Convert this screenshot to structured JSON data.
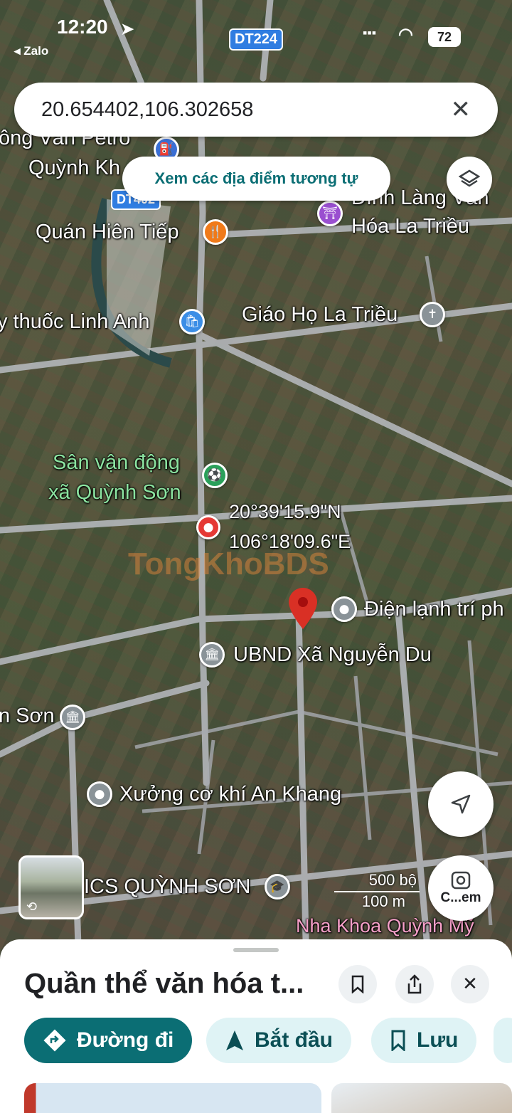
{
  "status_bar": {
    "time": "12:20",
    "back_app": "◂ Zalo",
    "signal": "▪▪▪",
    "battery": "72"
  },
  "road_badges": [
    "DT224",
    "DT402"
  ],
  "search": {
    "query": "20.654402,106.302658"
  },
  "similar_places_chip": "Xem các địa điểm tương tự",
  "map_labels": {
    "petro": "ông Văn Petro",
    "petro2": "Quỳnh Kh",
    "dinh_lang": "Đình Làng Văn",
    "dinh_lang2": "Hóa La Triều",
    "quan_hien_tiep": "Quán Hiên Tiếp",
    "thuoc": "y thuốc Linh Anh",
    "giao_ho": "Giáo Họ La Triều",
    "svd1": "Sân vận động",
    "svd2": "xã Quỳnh Sơn",
    "coord_lat": "20°39'15.9\"N",
    "coord_lng": "106°18'09.6\"E",
    "watermark": "TongKhoBDS",
    "dien_lanh": "Điện lạnh trí ph",
    "ubnd": "UBND Xã Nguyễn Du",
    "son": "n Sơn",
    "xuong": "Xưởng cơ khí An Khang",
    "thcs": "ICS QUỲNH SƠN",
    "nha_khoa": "Nha Khoa Quỳnh Mỹ"
  },
  "scale": {
    "top": "500 bộ",
    "bottom": "100 m"
  },
  "camera_button_label": "C...em",
  "place": {
    "title": "Quần thể văn hóa t...",
    "actions": {
      "directions": "Đường đi",
      "start": "Bắt đầu",
      "save": "Lưu"
    }
  },
  "icons": [
    "layers-icon",
    "close-icon",
    "navigation-arrow-icon",
    "visual-search-icon",
    "bookmark-icon",
    "share-icon",
    "directions-icon"
  ]
}
